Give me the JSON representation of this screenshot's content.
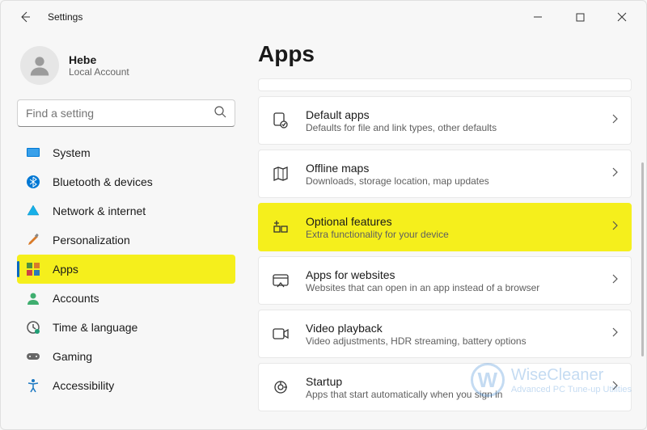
{
  "window": {
    "title": "Settings"
  },
  "account": {
    "name": "Hebe",
    "sub": "Local Account"
  },
  "search": {
    "placeholder": "Find a setting"
  },
  "sidebar": {
    "items": [
      {
        "label": "System"
      },
      {
        "label": "Bluetooth & devices"
      },
      {
        "label": "Network & internet"
      },
      {
        "label": "Personalization"
      },
      {
        "label": "Apps"
      },
      {
        "label": "Accounts"
      },
      {
        "label": "Time & language"
      },
      {
        "label": "Gaming"
      },
      {
        "label": "Accessibility"
      }
    ]
  },
  "page": {
    "title": "Apps"
  },
  "cards": [
    {
      "title": "Default apps",
      "sub": "Defaults for file and link types, other defaults"
    },
    {
      "title": "Offline maps",
      "sub": "Downloads, storage location, map updates"
    },
    {
      "title": "Optional features",
      "sub": "Extra functionality for your device"
    },
    {
      "title": "Apps for websites",
      "sub": "Websites that can open in an app instead of a browser"
    },
    {
      "title": "Video playback",
      "sub": "Video adjustments, HDR streaming, battery options"
    },
    {
      "title": "Startup",
      "sub": "Apps that start automatically when you sign in"
    }
  ],
  "watermark": {
    "brand": "WiseCleaner",
    "tag": "Advanced PC Tune-up Utilities",
    "initial": "W"
  }
}
